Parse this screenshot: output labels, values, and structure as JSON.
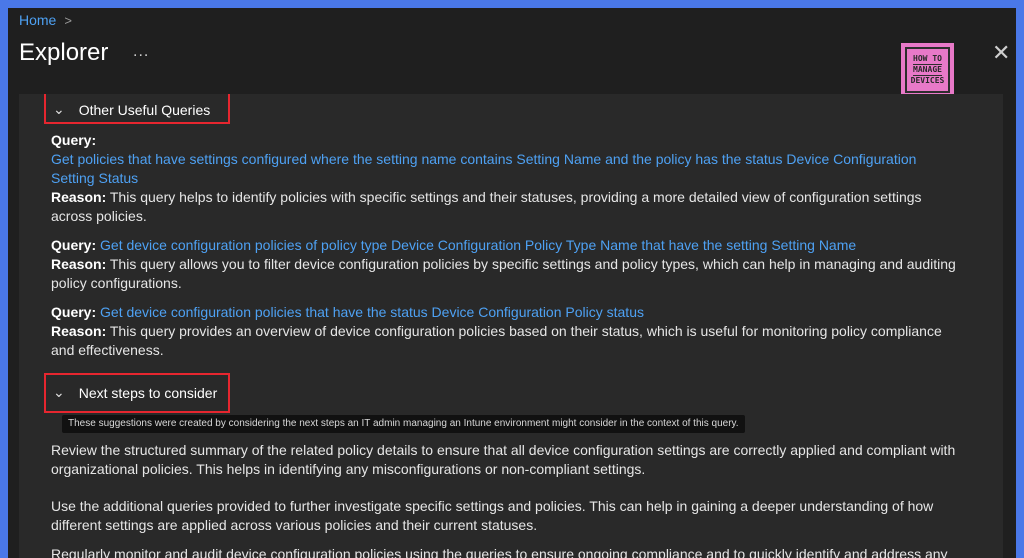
{
  "breadcrumb": {
    "home": "Home",
    "separator": ">"
  },
  "header": {
    "title": "Explorer",
    "more": "...",
    "close": "✕"
  },
  "logo": {
    "line1": "HOW TO",
    "line2": "MANAGE",
    "line3": "DEVICES"
  },
  "sections": {
    "other_queries": {
      "heading": "Other Useful Queries",
      "items": [
        {
          "query_label": "Query:",
          "query_link": "Get policies that have settings configured where the setting name contains Setting Name and the policy has the status Device Configuration Setting Status",
          "reason_label": "Reason:",
          "reason_text": "This query helps to identify policies with specific settings and their statuses, providing a more detailed view of configuration settings across policies."
        },
        {
          "query_label": "Query:",
          "query_link": "Get device configuration policies of policy type Device Configuration Policy Type Name that have the setting Setting Name",
          "reason_label": "Reason:",
          "reason_text": "This query allows you to filter device configuration policies by specific settings and policy types, which can help in managing and auditing policy configurations."
        },
        {
          "query_label": "Query:",
          "query_link": "Get device configuration policies that have the status Device Configuration Policy status",
          "reason_label": "Reason:",
          "reason_text": "This query provides an overview of device configuration policies based on their status, which is useful for monitoring policy compliance and effectiveness."
        }
      ]
    },
    "next_steps": {
      "heading": "Next steps to consider",
      "tooltip": "These suggestions were created by considering the next steps an IT admin managing an Intune environment might consider in the context of this query.",
      "paragraphs": [
        "Review the structured summary of the related policy details to ensure that all device configuration settings are correctly applied and compliant with organizational policies. This helps in identifying any misconfigurations or non-compliant settings.",
        "Use the additional queries provided to further investigate specific settings and policies. This can help in gaining a deeper understanding of how different settings are applied across various policies and their current statuses.",
        "Regularly monitor and audit device configuration policies using the queries to ensure ongoing compliance and to quickly identify and address any"
      ]
    }
  },
  "colors": {
    "accent": "#4ea1f3",
    "highlight": "#e6262f",
    "border": "#4a78e8"
  }
}
